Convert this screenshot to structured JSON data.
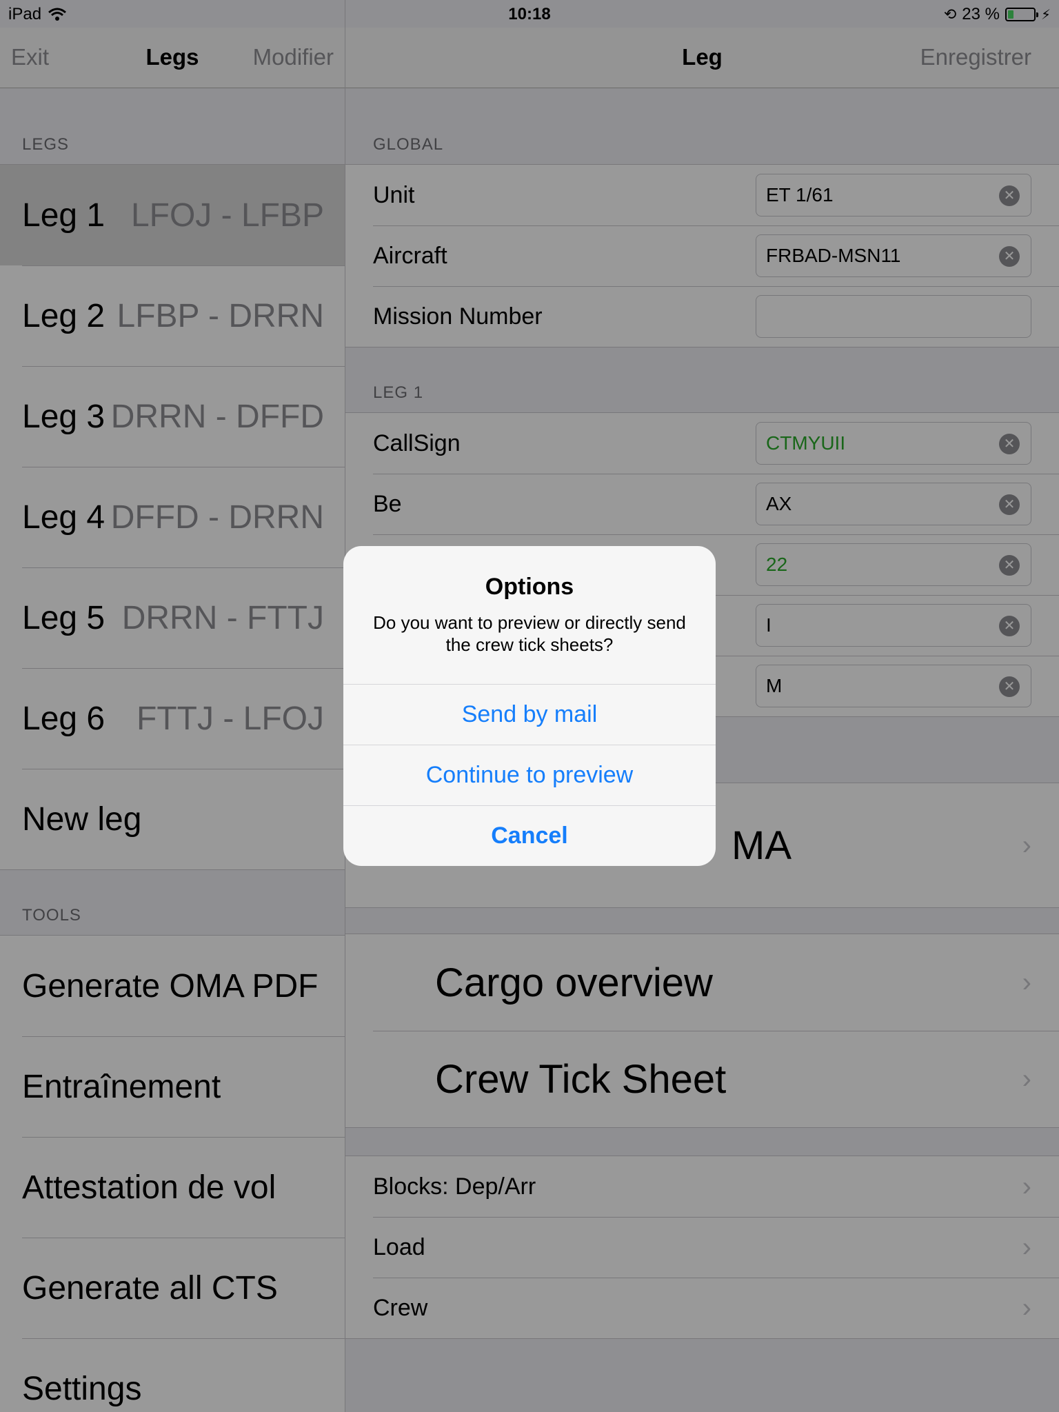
{
  "status_bar": {
    "device": "iPad",
    "time": "10:18",
    "battery_pct": "23 %",
    "battery_level": 0.23
  },
  "master": {
    "nav": {
      "left": "Exit",
      "title": "Legs",
      "right": "Modifier"
    },
    "legs_header": "LEGS",
    "legs": [
      {
        "name": "Leg 1",
        "route": "LFOJ - LFBP",
        "selected": true
      },
      {
        "name": "Leg 2",
        "route": "LFBP - DRRN"
      },
      {
        "name": "Leg 3",
        "route": "DRRN - DFFD"
      },
      {
        "name": "Leg 4",
        "route": "DFFD - DRRN"
      },
      {
        "name": "Leg 5",
        "route": "DRRN - FTTJ"
      },
      {
        "name": "Leg 6",
        "route": "FTTJ - LFOJ"
      }
    ],
    "new_leg": "New leg",
    "tools_header": "TOOLS",
    "tools": [
      "Generate OMA PDF",
      "Entraînement",
      "Attestation de vol",
      "Generate all CTS",
      "Settings"
    ]
  },
  "detail": {
    "nav": {
      "title": "Leg",
      "right": "Enregistrer"
    },
    "global_header": "GLOBAL",
    "global_fields": [
      {
        "label": "Unit",
        "value": "ET 1/61"
      },
      {
        "label": "Aircraft",
        "value": "FRBAD-MSN11"
      },
      {
        "label": "Mission Number",
        "value": ""
      }
    ],
    "leg_header": "LEG 1",
    "leg_fields": [
      {
        "label": "CallSign",
        "value": "CTMYUII"
      },
      {
        "label": "Be",
        "value": "AX"
      },
      {
        "label": "",
        "value": "22"
      },
      {
        "label": "",
        "value": "I"
      },
      {
        "label": "",
        "value": "M"
      }
    ],
    "oma_text": "MA",
    "big_rows": [
      "Cargo overview",
      "Crew Tick Sheet"
    ],
    "small_rows": [
      "Blocks: Dep/Arr",
      "Load",
      "Crew"
    ]
  },
  "alert": {
    "title": "Options",
    "message": "Do you want to preview or directly send the crew tick sheets?",
    "buttons": [
      "Send by mail",
      "Continue to preview",
      "Cancel"
    ]
  },
  "colors": {
    "tint": "#157efb",
    "green_value": "#2bab2b",
    "separator": "#c8c7cc"
  }
}
